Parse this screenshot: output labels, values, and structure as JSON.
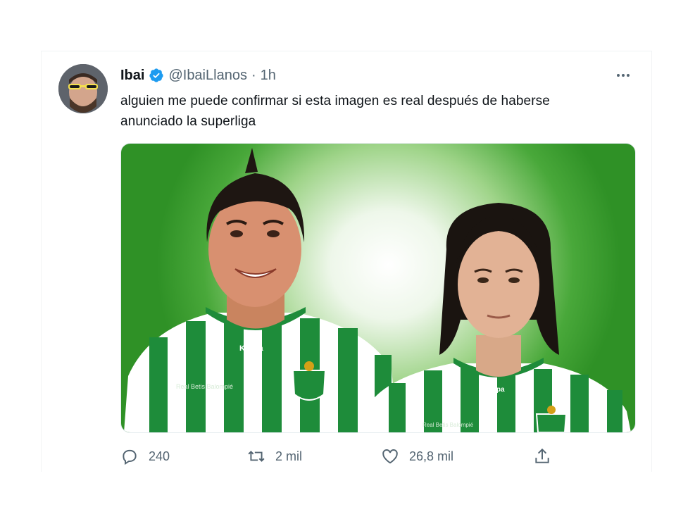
{
  "tweet": {
    "display_name": "Ibai",
    "handle": "@IbaiLlanos",
    "separator": "·",
    "time": "1h",
    "text_line1": "alguien me puede confirmar si esta imagen es real después de haberse",
    "text_line2": "anunciado la superliga",
    "verified_color": "#1d9bf0",
    "media_caption": {
      "kit_brand": "Kappa",
      "sponsor": "Real Betis Balompié"
    }
  },
  "actions": {
    "reply_count": "240",
    "retweet_count": "2 mil",
    "like_count": "26,8 mil"
  },
  "icons": [
    "verified-icon",
    "more-options-icon",
    "reply-icon",
    "retweet-icon",
    "like-icon",
    "share-icon"
  ],
  "colors": {
    "text": "#0f1419",
    "secondary": "#536471",
    "accent": "#1d9bf0",
    "jersey_green": "#1e8c3a"
  }
}
